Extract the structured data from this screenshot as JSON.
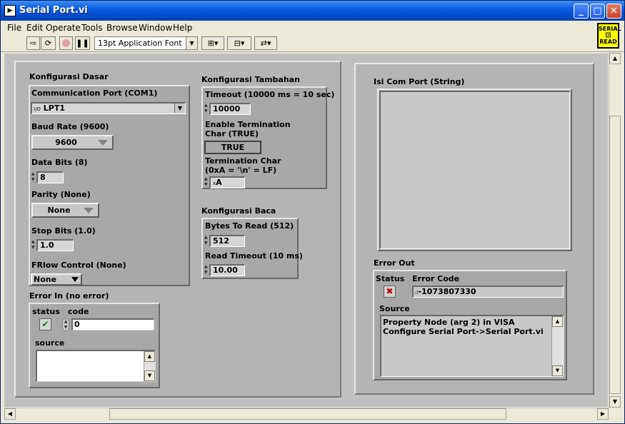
{
  "window": {
    "title": "Serial Port.vi",
    "app_icon": "labview-vi-icon",
    "minimize": "_",
    "maximize": "□",
    "close": "✕"
  },
  "menu": [
    "File",
    "Edit",
    "Operate",
    "Tools",
    "Browse",
    "Window",
    "Help"
  ],
  "toolbar": {
    "font": "13pt Application Font"
  },
  "vi_icon": {
    "line1": "SERIAL",
    "line2": "READ"
  },
  "konfigurasi_dasar": {
    "title": "Konfigurasi Dasar",
    "comm_port_label": "Communication Port (COM1)",
    "comm_port_value": "LPT1",
    "comm_port_prefix": "I/O",
    "baud_label": "Baud Rate (9600)",
    "baud_value": "9600",
    "databits_label": "Data Bits (8)",
    "databits_value": "8",
    "parity_label": "Parity (None)",
    "parity_value": "None",
    "stopbits_label": "Stop Bits (1.0)",
    "stopbits_value": "1.0",
    "flow_label": "FRlow Control (None)",
    "flow_value": "None"
  },
  "konfigurasi_tambahan": {
    "title": "Konfigurasi Tambahan",
    "timeout_label": "Timeout (10000 ms = 10 sec)",
    "timeout_value": "10000",
    "enable_term_label1": "Enable Termination",
    "enable_term_label2": "Char (TRUE)",
    "enable_term_value": "TRUE",
    "term_char_label1": "Termination Char",
    "term_char_label2": "(0xA = '\\n' = LF)",
    "term_char_value": "A",
    "term_char_prefix": "x"
  },
  "konfigurasi_baca": {
    "title": "Konfigurasi Baca",
    "bytes_label": "Bytes To Read (512)",
    "bytes_value": "512",
    "read_timeout_label": "Read Timeout (10 ms)",
    "read_timeout_value": "10.00"
  },
  "error_in": {
    "title": "Error In (no error)",
    "status_label": "status",
    "code_label": "code",
    "code_value": "0",
    "status_icon": "check-icon",
    "source_label": "source",
    "source_value": ""
  },
  "isi_com_port": {
    "title": "Isi Com Port (String)",
    "value": ""
  },
  "error_out": {
    "title": "Error Out",
    "status_label": "Status",
    "code_label": "Error Code",
    "status_icon": "x-icon",
    "code_prefix": "d",
    "code_value": "-1073807330",
    "source_label": "Source",
    "source_value": "Property Node (arg 2) in VISA Configure Serial Port->Serial Port.vi"
  }
}
